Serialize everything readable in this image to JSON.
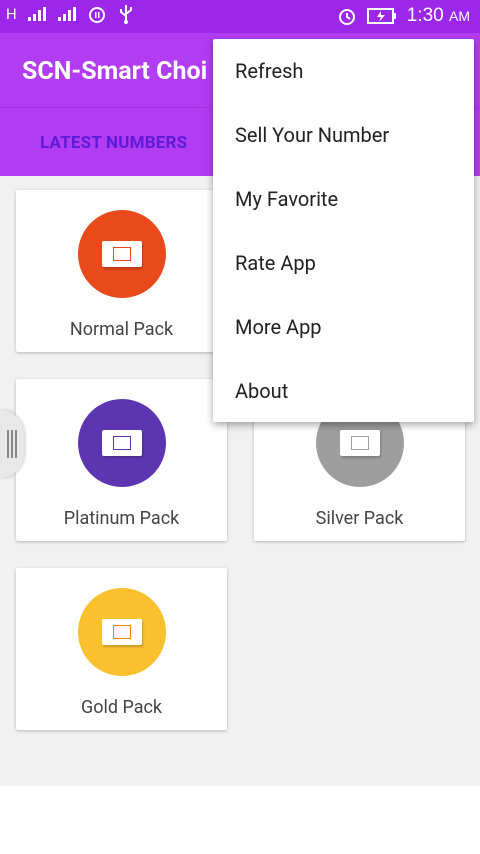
{
  "status_bar": {
    "network_label": "H",
    "time": "1:30",
    "ampm": "AM",
    "icons": [
      "network-h-icon",
      "signal-icon",
      "signal-icon",
      "alarm-icon",
      "usb-icon",
      "alarm-icon",
      "battery-charging-icon"
    ]
  },
  "app_bar": {
    "title": "SCN-Smart Choi",
    "tabs": [
      {
        "label": "LATEST NUMBERS"
      }
    ]
  },
  "cards": [
    {
      "label": "Normal Pack",
      "color": "#e84a1b",
      "chip_color": "#e84a1b"
    },
    {
      "label": "Platinum Pack",
      "color": "#5e35b1",
      "chip_color": "#5e35b1"
    },
    {
      "label": "Silver Pack",
      "color": "#9e9e9e",
      "chip_color": "#9e9e9e"
    },
    {
      "label": "Gold Pack",
      "color": "#fbc02d",
      "chip_color": "#e08a00"
    }
  ],
  "menu": {
    "items": [
      {
        "label": "Refresh"
      },
      {
        "label": "Sell Your Number"
      },
      {
        "label": "My Favorite"
      },
      {
        "label": "Rate App"
      },
      {
        "label": "More App"
      },
      {
        "label": "About"
      }
    ]
  },
  "colors": {
    "status_bar": "#9c27e8",
    "app_bar": "#b23cf2",
    "tab_text": "#5e1bd6",
    "background": "#f1f1f1"
  }
}
